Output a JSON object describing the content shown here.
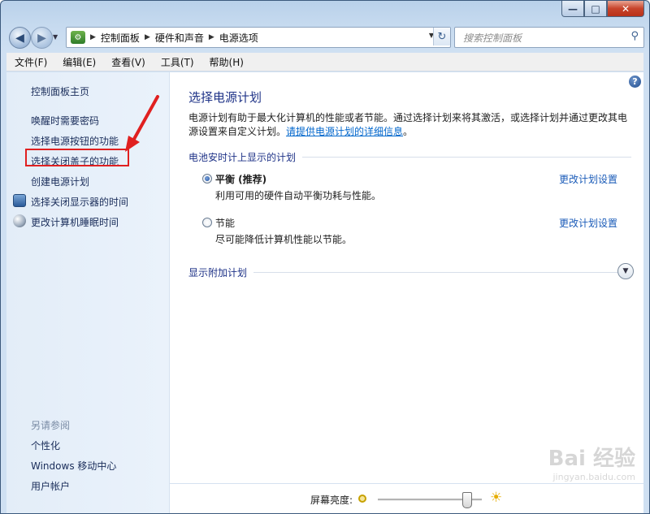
{
  "window": {
    "minimize_label": "—",
    "maximize_label": "□",
    "close_label": "✕"
  },
  "nav": {
    "back_glyph": "◀",
    "forward_glyph": "▶",
    "breadcrumbs": [
      "控制面板",
      "硬件和声音",
      "电源选项"
    ],
    "search_placeholder": "搜索控制面板"
  },
  "menubar": {
    "items": [
      "文件(F)",
      "编辑(E)",
      "查看(V)",
      "工具(T)",
      "帮助(H)"
    ]
  },
  "sidebar": {
    "home": "控制面板主页",
    "links": [
      "唤醒时需要密码",
      "选择电源按钮的功能",
      "选择关闭盖子的功能",
      "创建电源计划"
    ],
    "icon_links": [
      {
        "label": "选择关闭显示器的时间",
        "icon": "monitor-icon"
      },
      {
        "label": "更改计算机睡眠时间",
        "icon": "moon-icon"
      }
    ],
    "see_also_heading": "另请参阅",
    "see_also": [
      "个性化",
      "Windows 移动中心",
      "用户帐户"
    ]
  },
  "main": {
    "help_glyph": "?",
    "title": "选择电源计划",
    "description": "电源计划有助于最大化计算机的性能或者节能。通过选择计划来将其激活，或选择计划并通过更改其电源设置来自定义计划。",
    "description_link": "请提供电源计划的详细信息",
    "description_end": "。",
    "group_header": "电池安时计上显示的计划",
    "plans": [
      {
        "name": "平衡 (推荐)",
        "description": "利用可用的硬件自动平衡功耗与性能。",
        "selected": true,
        "settings_link": "更改计划设置"
      },
      {
        "name": "节能",
        "description": "尽可能降低计算机性能以节能。",
        "selected": false,
        "settings_link": "更改计划设置"
      }
    ],
    "additional_plans": "显示附加计划"
  },
  "brightness": {
    "label": "屏幕亮度:",
    "level_percent": 85
  },
  "watermark": {
    "brand": "Bai 经验",
    "url": "jingyan.baidu.com"
  }
}
